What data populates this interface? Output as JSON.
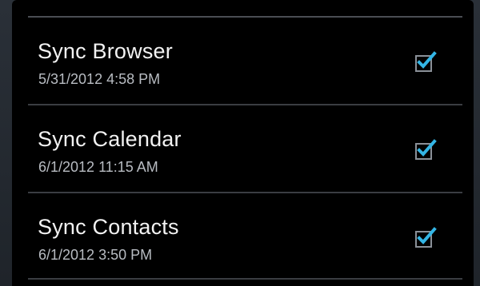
{
  "accent_color": "#33b5e5",
  "sync_items": [
    {
      "title": "Sync Browser",
      "timestamp": "5/31/2012 4:58 PM",
      "checked": true,
      "icon": "checkbox-checked-icon"
    },
    {
      "title": "Sync Calendar",
      "timestamp": "6/1/2012 11:15 AM",
      "checked": true,
      "icon": "checkbox-checked-icon"
    },
    {
      "title": "Sync Contacts",
      "timestamp": "6/1/2012 3:50 PM",
      "checked": true,
      "icon": "checkbox-checked-icon"
    }
  ]
}
